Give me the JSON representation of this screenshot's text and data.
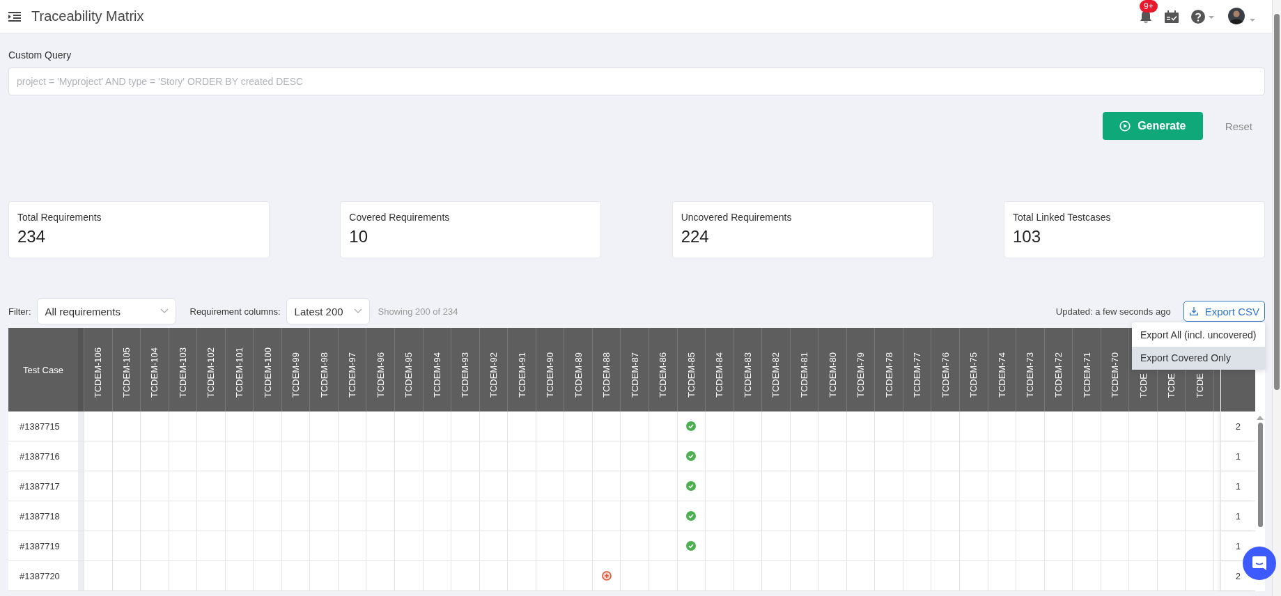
{
  "topbar": {
    "title": "Traceability Matrix",
    "notification_badge": "9+"
  },
  "query": {
    "label": "Custom Query",
    "placeholder": "project = 'Myproject' AND type = 'Story' ORDER BY created DESC"
  },
  "actions": {
    "generate": "Generate",
    "reset": "Reset"
  },
  "stats": [
    {
      "label": "Total Requirements",
      "value": "234"
    },
    {
      "label": "Covered Requirements",
      "value": "10"
    },
    {
      "label": "Uncovered Requirements",
      "value": "224"
    },
    {
      "label": "Total Linked Testcases",
      "value": "103"
    }
  ],
  "toolbar": {
    "filter_label": "Filter:",
    "filter_value": "All requirements",
    "columns_label": "Requirement columns:",
    "columns_value": "Latest 200",
    "showing": "Showing 200 of 234",
    "updated": "Updated: a few seconds ago",
    "export": "Export CSV"
  },
  "export_menu": [
    {
      "label": "Export All (incl. uncovered)",
      "highlighted": false
    },
    {
      "label": "Export Covered Only",
      "highlighted": true
    }
  ],
  "matrix": {
    "first_column": "Test Case",
    "columns": [
      "TCDEM-106",
      "TCDEM-105",
      "TCDEM-104",
      "TCDEM-103",
      "TCDEM-102",
      "TCDEM-101",
      "TCDEM-100",
      "TCDEM-99",
      "TCDEM-98",
      "TCDEM-97",
      "TCDEM-96",
      "TCDEM-95",
      "TCDEM-94",
      "TCDEM-93",
      "TCDEM-92",
      "TCDEM-91",
      "TCDEM-90",
      "TCDEM-89",
      "TCDEM-88",
      "TCDEM-87",
      "TCDEM-86",
      "TCDEM-85",
      "TCDEM-84",
      "TCDEM-83",
      "TCDEM-82",
      "TCDEM-81",
      "TCDEM-80",
      "TCDEM-79",
      "TCDEM-78",
      "TCDEM-77",
      "TCDEM-76",
      "TCDEM-75",
      "TCDEM-74",
      "TCDEM-73",
      "TCDEM-72",
      "TCDEM-71",
      "TCDEM-70",
      "TCDE",
      "TCDE",
      "TCDE"
    ],
    "rows": [
      {
        "test_case": "#1387715",
        "total": "2",
        "cells": [
          {
            "covered": false,
            "flagged": false
          },
          {
            "covered": false,
            "flagged": false
          },
          {
            "covered": false,
            "flagged": false
          },
          {
            "covered": false,
            "flagged": false
          },
          {
            "covered": false,
            "flagged": false
          },
          {
            "covered": false,
            "flagged": false
          },
          {
            "covered": false,
            "flagged": false
          },
          {
            "covered": false,
            "flagged": false
          },
          {
            "covered": false,
            "flagged": false
          },
          {
            "covered": false,
            "flagged": false
          },
          {
            "covered": false,
            "flagged": false
          },
          {
            "covered": false,
            "flagged": false
          },
          {
            "covered": false,
            "flagged": false
          },
          {
            "covered": false,
            "flagged": false
          },
          {
            "covered": false,
            "flagged": false
          },
          {
            "covered": false,
            "flagged": false
          },
          {
            "covered": false,
            "flagged": false
          },
          {
            "covered": false,
            "flagged": false
          },
          {
            "covered": false,
            "flagged": false
          },
          {
            "covered": false,
            "flagged": false
          },
          {
            "covered": false,
            "flagged": false
          },
          {
            "covered": true,
            "flagged": false
          },
          {
            "covered": false,
            "flagged": false
          },
          {
            "covered": false,
            "flagged": false
          },
          {
            "covered": false,
            "flagged": false
          },
          {
            "covered": false,
            "flagged": false
          },
          {
            "covered": false,
            "flagged": false
          },
          {
            "covered": false,
            "flagged": false
          },
          {
            "covered": false,
            "flagged": false
          },
          {
            "covered": false,
            "flagged": false
          },
          {
            "covered": false,
            "flagged": false
          },
          {
            "covered": false,
            "flagged": false
          },
          {
            "covered": false,
            "flagged": false
          },
          {
            "covered": false,
            "flagged": false
          },
          {
            "covered": false,
            "flagged": false
          },
          {
            "covered": false,
            "flagged": false
          },
          {
            "covered": false,
            "flagged": false
          },
          {
            "covered": false,
            "flagged": false
          },
          {
            "covered": false,
            "flagged": false
          },
          {
            "covered": false,
            "flagged": false
          }
        ]
      },
      {
        "test_case": "#1387716",
        "total": "1",
        "cells": [
          {
            "covered": false,
            "flagged": false
          },
          {
            "covered": false,
            "flagged": false
          },
          {
            "covered": false,
            "flagged": false
          },
          {
            "covered": false,
            "flagged": false
          },
          {
            "covered": false,
            "flagged": false
          },
          {
            "covered": false,
            "flagged": false
          },
          {
            "covered": false,
            "flagged": false
          },
          {
            "covered": false,
            "flagged": false
          },
          {
            "covered": false,
            "flagged": false
          },
          {
            "covered": false,
            "flagged": false
          },
          {
            "covered": false,
            "flagged": false
          },
          {
            "covered": false,
            "flagged": false
          },
          {
            "covered": false,
            "flagged": false
          },
          {
            "covered": false,
            "flagged": false
          },
          {
            "covered": false,
            "flagged": false
          },
          {
            "covered": false,
            "flagged": false
          },
          {
            "covered": false,
            "flagged": false
          },
          {
            "covered": false,
            "flagged": false
          },
          {
            "covered": false,
            "flagged": false
          },
          {
            "covered": false,
            "flagged": false
          },
          {
            "covered": false,
            "flagged": false
          },
          {
            "covered": true,
            "flagged": false
          },
          {
            "covered": false,
            "flagged": false
          },
          {
            "covered": false,
            "flagged": false
          },
          {
            "covered": false,
            "flagged": false
          },
          {
            "covered": false,
            "flagged": false
          },
          {
            "covered": false,
            "flagged": false
          },
          {
            "covered": false,
            "flagged": false
          },
          {
            "covered": false,
            "flagged": false
          },
          {
            "covered": false,
            "flagged": false
          },
          {
            "covered": false,
            "flagged": false
          },
          {
            "covered": false,
            "flagged": false
          },
          {
            "covered": false,
            "flagged": false
          },
          {
            "covered": false,
            "flagged": false
          },
          {
            "covered": false,
            "flagged": false
          },
          {
            "covered": false,
            "flagged": false
          },
          {
            "covered": false,
            "flagged": false
          },
          {
            "covered": false,
            "flagged": false
          },
          {
            "covered": false,
            "flagged": false
          },
          {
            "covered": false,
            "flagged": false
          }
        ]
      },
      {
        "test_case": "#1387717",
        "total": "1",
        "cells": [
          {
            "covered": false,
            "flagged": false
          },
          {
            "covered": false,
            "flagged": false
          },
          {
            "covered": false,
            "flagged": false
          },
          {
            "covered": false,
            "flagged": false
          },
          {
            "covered": false,
            "flagged": false
          },
          {
            "covered": false,
            "flagged": false
          },
          {
            "covered": false,
            "flagged": false
          },
          {
            "covered": false,
            "flagged": false
          },
          {
            "covered": false,
            "flagged": false
          },
          {
            "covered": false,
            "flagged": false
          },
          {
            "covered": false,
            "flagged": false
          },
          {
            "covered": false,
            "flagged": false
          },
          {
            "covered": false,
            "flagged": false
          },
          {
            "covered": false,
            "flagged": false
          },
          {
            "covered": false,
            "flagged": false
          },
          {
            "covered": false,
            "flagged": false
          },
          {
            "covered": false,
            "flagged": false
          },
          {
            "covered": false,
            "flagged": false
          },
          {
            "covered": false,
            "flagged": false
          },
          {
            "covered": false,
            "flagged": false
          },
          {
            "covered": false,
            "flagged": false
          },
          {
            "covered": true,
            "flagged": false
          },
          {
            "covered": false,
            "flagged": false
          },
          {
            "covered": false,
            "flagged": false
          },
          {
            "covered": false,
            "flagged": false
          },
          {
            "covered": false,
            "flagged": false
          },
          {
            "covered": false,
            "flagged": false
          },
          {
            "covered": false,
            "flagged": false
          },
          {
            "covered": false,
            "flagged": false
          },
          {
            "covered": false,
            "flagged": false
          },
          {
            "covered": false,
            "flagged": false
          },
          {
            "covered": false,
            "flagged": false
          },
          {
            "covered": false,
            "flagged": false
          },
          {
            "covered": false,
            "flagged": false
          },
          {
            "covered": false,
            "flagged": false
          },
          {
            "covered": false,
            "flagged": false
          },
          {
            "covered": false,
            "flagged": false
          },
          {
            "covered": false,
            "flagged": false
          },
          {
            "covered": false,
            "flagged": false
          },
          {
            "covered": false,
            "flagged": false
          }
        ]
      },
      {
        "test_case": "#1387718",
        "total": "1",
        "cells": [
          {
            "covered": false,
            "flagged": false
          },
          {
            "covered": false,
            "flagged": false
          },
          {
            "covered": false,
            "flagged": false
          },
          {
            "covered": false,
            "flagged": false
          },
          {
            "covered": false,
            "flagged": false
          },
          {
            "covered": false,
            "flagged": false
          },
          {
            "covered": false,
            "flagged": false
          },
          {
            "covered": false,
            "flagged": false
          },
          {
            "covered": false,
            "flagged": false
          },
          {
            "covered": false,
            "flagged": false
          },
          {
            "covered": false,
            "flagged": false
          },
          {
            "covered": false,
            "flagged": false
          },
          {
            "covered": false,
            "flagged": false
          },
          {
            "covered": false,
            "flagged": false
          },
          {
            "covered": false,
            "flagged": false
          },
          {
            "covered": false,
            "flagged": false
          },
          {
            "covered": false,
            "flagged": false
          },
          {
            "covered": false,
            "flagged": false
          },
          {
            "covered": false,
            "flagged": false
          },
          {
            "covered": false,
            "flagged": false
          },
          {
            "covered": false,
            "flagged": false
          },
          {
            "covered": true,
            "flagged": false
          },
          {
            "covered": false,
            "flagged": false
          },
          {
            "covered": false,
            "flagged": false
          },
          {
            "covered": false,
            "flagged": false
          },
          {
            "covered": false,
            "flagged": false
          },
          {
            "covered": false,
            "flagged": false
          },
          {
            "covered": false,
            "flagged": false
          },
          {
            "covered": false,
            "flagged": false
          },
          {
            "covered": false,
            "flagged": false
          },
          {
            "covered": false,
            "flagged": false
          },
          {
            "covered": false,
            "flagged": false
          },
          {
            "covered": false,
            "flagged": false
          },
          {
            "covered": false,
            "flagged": false
          },
          {
            "covered": false,
            "flagged": false
          },
          {
            "covered": false,
            "flagged": false
          },
          {
            "covered": false,
            "flagged": false
          },
          {
            "covered": false,
            "flagged": false
          },
          {
            "covered": false,
            "flagged": false
          },
          {
            "covered": false,
            "flagged": false
          }
        ]
      },
      {
        "test_case": "#1387719",
        "total": "1",
        "cells": [
          {
            "covered": false,
            "flagged": false
          },
          {
            "covered": false,
            "flagged": false
          },
          {
            "covered": false,
            "flagged": false
          },
          {
            "covered": false,
            "flagged": false
          },
          {
            "covered": false,
            "flagged": false
          },
          {
            "covered": false,
            "flagged": false
          },
          {
            "covered": false,
            "flagged": false
          },
          {
            "covered": false,
            "flagged": false
          },
          {
            "covered": false,
            "flagged": false
          },
          {
            "covered": false,
            "flagged": false
          },
          {
            "covered": false,
            "flagged": false
          },
          {
            "covered": false,
            "flagged": false
          },
          {
            "covered": false,
            "flagged": false
          },
          {
            "covered": false,
            "flagged": false
          },
          {
            "covered": false,
            "flagged": false
          },
          {
            "covered": false,
            "flagged": false
          },
          {
            "covered": false,
            "flagged": false
          },
          {
            "covered": false,
            "flagged": false
          },
          {
            "covered": false,
            "flagged": false
          },
          {
            "covered": false,
            "flagged": false
          },
          {
            "covered": false,
            "flagged": false
          },
          {
            "covered": true,
            "flagged": false
          },
          {
            "covered": false,
            "flagged": false
          },
          {
            "covered": false,
            "flagged": false
          },
          {
            "covered": false,
            "flagged": false
          },
          {
            "covered": false,
            "flagged": false
          },
          {
            "covered": false,
            "flagged": false
          },
          {
            "covered": false,
            "flagged": false
          },
          {
            "covered": false,
            "flagged": false
          },
          {
            "covered": false,
            "flagged": false
          },
          {
            "covered": false,
            "flagged": false
          },
          {
            "covered": false,
            "flagged": false
          },
          {
            "covered": false,
            "flagged": false
          },
          {
            "covered": false,
            "flagged": false
          },
          {
            "covered": false,
            "flagged": false
          },
          {
            "covered": false,
            "flagged": false
          },
          {
            "covered": false,
            "flagged": false
          },
          {
            "covered": false,
            "flagged": false
          },
          {
            "covered": false,
            "flagged": false
          },
          {
            "covered": false,
            "flagged": false
          }
        ]
      },
      {
        "test_case": "#1387720",
        "total": "2",
        "cells": [
          {
            "covered": false,
            "flagged": false
          },
          {
            "covered": false,
            "flagged": false
          },
          {
            "covered": false,
            "flagged": false
          },
          {
            "covered": false,
            "flagged": false
          },
          {
            "covered": false,
            "flagged": false
          },
          {
            "covered": false,
            "flagged": false
          },
          {
            "covered": false,
            "flagged": false
          },
          {
            "covered": false,
            "flagged": false
          },
          {
            "covered": false,
            "flagged": false
          },
          {
            "covered": false,
            "flagged": false
          },
          {
            "covered": false,
            "flagged": false
          },
          {
            "covered": false,
            "flagged": false
          },
          {
            "covered": false,
            "flagged": false
          },
          {
            "covered": false,
            "flagged": false
          },
          {
            "covered": false,
            "flagged": false
          },
          {
            "covered": false,
            "flagged": false
          },
          {
            "covered": false,
            "flagged": false
          },
          {
            "covered": false,
            "flagged": false
          },
          {
            "covered": false,
            "flagged": true
          },
          {
            "covered": false,
            "flagged": false
          },
          {
            "covered": false,
            "flagged": false
          },
          {
            "covered": false,
            "flagged": false
          },
          {
            "covered": false,
            "flagged": false
          },
          {
            "covered": false,
            "flagged": false
          },
          {
            "covered": false,
            "flagged": false
          },
          {
            "covered": false,
            "flagged": false
          },
          {
            "covered": false,
            "flagged": false
          },
          {
            "covered": false,
            "flagged": false
          },
          {
            "covered": false,
            "flagged": false
          },
          {
            "covered": false,
            "flagged": false
          },
          {
            "covered": false,
            "flagged": false
          },
          {
            "covered": false,
            "flagged": false
          },
          {
            "covered": false,
            "flagged": false
          },
          {
            "covered": false,
            "flagged": false
          },
          {
            "covered": false,
            "flagged": false
          },
          {
            "covered": false,
            "flagged": false
          },
          {
            "covered": false,
            "flagged": false
          },
          {
            "covered": false,
            "flagged": false
          },
          {
            "covered": false,
            "flagged": false
          },
          {
            "covered": false,
            "flagged": false
          }
        ]
      }
    ]
  }
}
